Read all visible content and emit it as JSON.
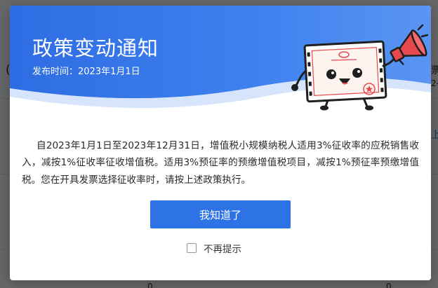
{
  "notice": {
    "title": "政策变动通知",
    "date_label": "发布时间：",
    "date_value": "2023年1月1日",
    "body": "自2023年1月1日至2023年12月31日，增值税小规模纳税人适用3%征收率的应税销售收入，减按1%征收率征收增值税。适用3%预征率的预缴增值税项目，减按1%预征率预缴增值税。您在开具发票选择征收率时，请按上述政策执行。",
    "confirm_label": "我知道了",
    "no_remind_label": "不再提示",
    "no_remind_checked": false
  },
  "background": {
    "left_fragment": "(",
    "right_fragment_1": "票",
    "right_fragment_2": "2-",
    "right_fragment_3": "上",
    "bottom_left_zero": "0",
    "bottom_right_zero": "0"
  },
  "colors": {
    "header_blue": "#3a7bea",
    "header_light": "#dbe8fd",
    "button_blue": "#2e73e6",
    "megaphone_red": "#e5484d"
  },
  "icons": {
    "illustration": "mascot-megaphone-icon",
    "checkbox": "checkbox-unchecked-icon"
  }
}
